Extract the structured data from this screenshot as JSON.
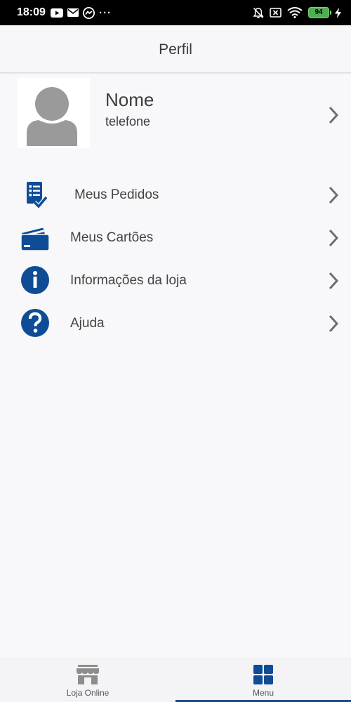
{
  "status_bar": {
    "time": "18:09",
    "more_indicator": "···",
    "battery": "94"
  },
  "header": {
    "title": "Perfil"
  },
  "profile": {
    "name": "Nome",
    "phone": "telefone"
  },
  "menu": [
    {
      "label": "Meus Pedidos",
      "icon": "order-list-icon"
    },
    {
      "label": "Meus Cartões",
      "icon": "credit-card-icon"
    },
    {
      "label": "Informações da loja",
      "icon": "info-icon"
    },
    {
      "label": "Ajuda",
      "icon": "help-icon"
    }
  ],
  "bottom_nav": {
    "tabs": [
      {
        "label": "Loja Online",
        "icon": "store-icon",
        "active": false
      },
      {
        "label": "Menu",
        "icon": "grid-icon",
        "active": true
      }
    ]
  },
  "colors": {
    "accent": "#0f4c96",
    "avatar_gray": "#9a9a9a",
    "chevron": "#6e6e6e"
  }
}
